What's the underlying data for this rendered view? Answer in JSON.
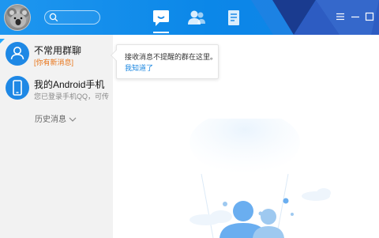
{
  "header": {
    "search": {
      "placeholder": "",
      "value": ""
    },
    "nav_tabs": [
      {
        "name": "messages",
        "icon": "chat-icon",
        "active": true
      },
      {
        "name": "contacts",
        "icon": "contacts-icon",
        "active": false
      },
      {
        "name": "space",
        "icon": "document-icon",
        "active": false
      }
    ],
    "window_controls": [
      "menu-icon",
      "minimize-icon",
      "maximize-icon"
    ],
    "colors": {
      "bar": "#0b87e8",
      "accent_dark": "#1a3b8f",
      "accent_light": "#3b6fd0"
    }
  },
  "sidebar": {
    "items": [
      {
        "title": "不常用群聊",
        "subtitle": "[你有新消息]",
        "icon": "group-icon",
        "subtitle_color": "#e8751a"
      },
      {
        "title": "我的Android手机",
        "subtitle": "您已登录手机QQ，可传",
        "icon": "phone-icon",
        "subtitle_color": "#888888"
      }
    ],
    "history_label": "历史消息"
  },
  "tooltip": {
    "text": "接收消息不提醒的群在这里。",
    "link": "我知道了"
  },
  "colors": {
    "primary": "#1e96ef",
    "link": "#1a86e0",
    "sidebar_bg": "#f2f2f2"
  }
}
